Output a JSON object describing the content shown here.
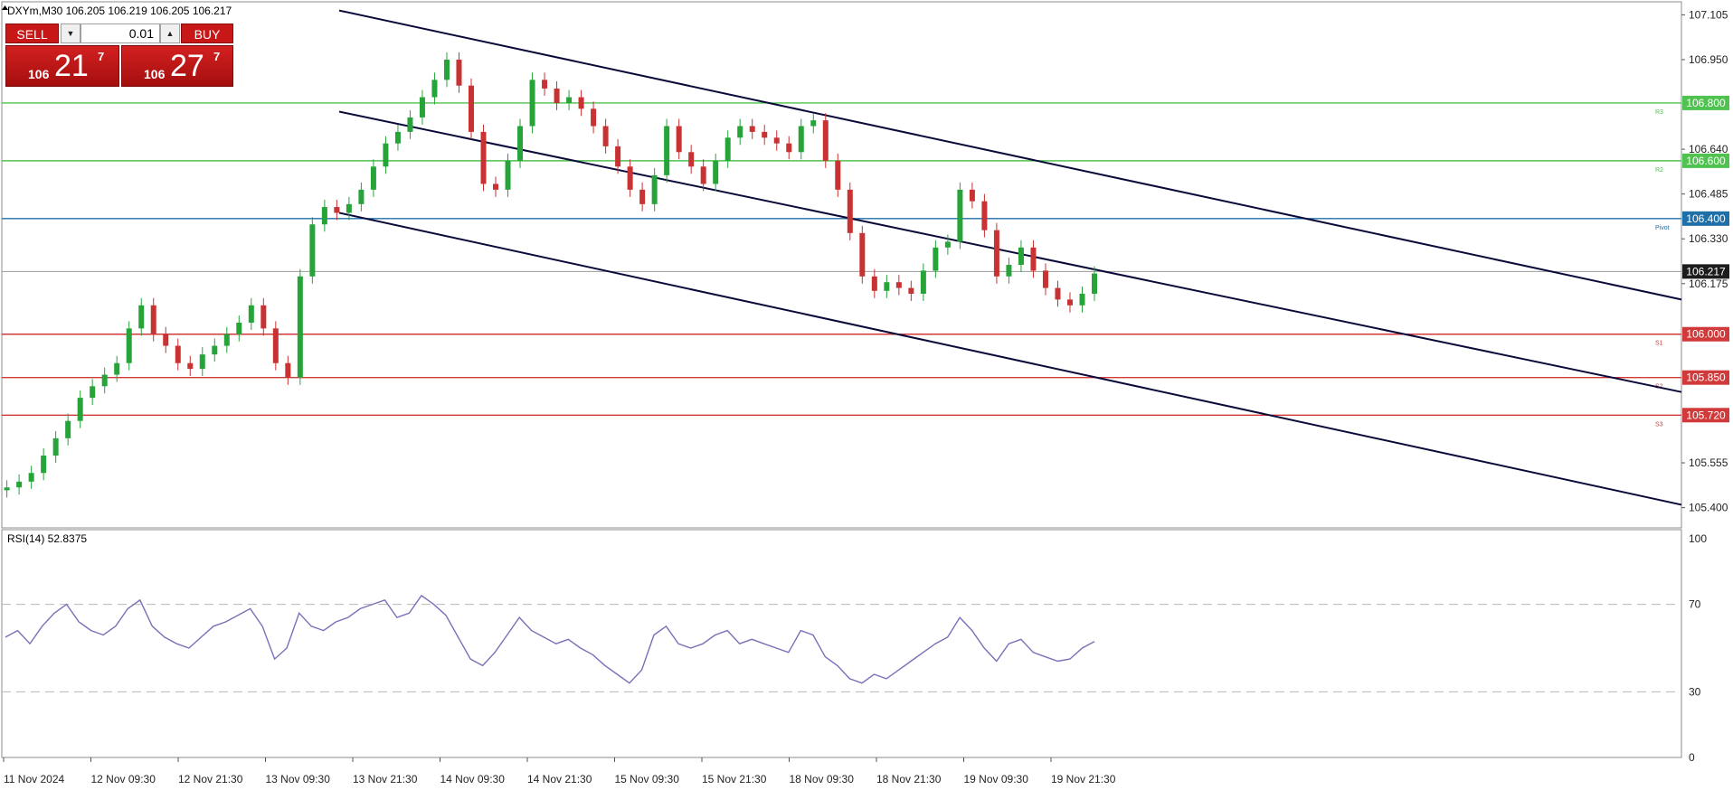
{
  "header": {
    "symbol_info": "DXYm,M30  106.205 106.219 106.205 106.217"
  },
  "trade_panel": {
    "sell_label": "SELL",
    "buy_label": "BUY",
    "lot": "0.01",
    "sell_price": {
      "prefix": "106",
      "big": "21",
      "sup": "7"
    },
    "buy_price": {
      "prefix": "106",
      "big": "27",
      "sup": "7"
    }
  },
  "colors": {
    "support": "#d03a3a",
    "resistance": "#4fc24f",
    "pivot": "#1f6fa8",
    "channel": "#0a0a3a",
    "candle_up": "#26a43a",
    "candle_down": "#c83232",
    "rsi": "#7b6fb8",
    "current": "#1c1c1c"
  },
  "chart_data": [
    {
      "type": "candlestick",
      "title": "DXYm,M30",
      "ylim": [
        105.33,
        107.15
      ],
      "yticks": [
        "107.105",
        "106.950",
        "106.640",
        "106.485",
        "106.330",
        "106.175",
        "105.555",
        "105.400"
      ],
      "x_labels": [
        "11 Nov 2024",
        "12 Nov 09:30",
        "12 Nov 21:30",
        "13 Nov 09:30",
        "13 Nov 21:30",
        "14 Nov 09:30",
        "14 Nov 21:30",
        "15 Nov 09:30",
        "15 Nov 21:30",
        "18 Nov 09:30",
        "18 Nov 21:30",
        "19 Nov 09:30",
        "19 Nov 21:30"
      ],
      "current_price": "106.217",
      "levels": [
        {
          "price": 106.8,
          "label": "106.800",
          "tag": "R3",
          "kind": "resistance"
        },
        {
          "price": 106.6,
          "label": "106.600",
          "tag": "R2",
          "kind": "resistance"
        },
        {
          "price": 106.4,
          "label": "106.400",
          "tag": "Pivot",
          "kind": "pivot"
        },
        {
          "price": 106.0,
          "label": "106.000",
          "tag": "S1",
          "kind": "support"
        },
        {
          "price": 105.85,
          "label": "105.850",
          "tag": "S2",
          "kind": "support"
        },
        {
          "price": 105.72,
          "label": "105.720",
          "tag": "S3",
          "kind": "support"
        }
      ],
      "channel_lines": [
        {
          "x1": 2,
          "y1": 107.12,
          "x2": 163,
          "y2": 106.12
        },
        {
          "x1": 2,
          "y1": 106.77,
          "x2": 163,
          "y2": 105.8
        },
        {
          "x1": 2,
          "y1": 106.42,
          "x2": 163,
          "y2": 105.41
        }
      ],
      "series": [
        {
          "name": "close",
          "values": [
            105.47,
            105.49,
            105.52,
            105.58,
            105.64,
            105.7,
            105.78,
            105.82,
            105.86,
            105.9,
            106.02,
            106.1,
            106.0,
            105.96,
            105.9,
            105.88,
            105.93,
            105.96,
            106.0,
            106.04,
            106.1,
            106.02,
            105.9,
            105.85,
            106.2,
            106.38,
            106.44,
            106.42,
            106.45,
            106.5,
            106.58,
            106.66,
            106.7,
            106.75,
            106.82,
            106.88,
            106.95,
            106.86,
            106.7,
            106.52,
            106.5,
            106.6,
            106.72,
            106.88,
            106.85,
            106.8,
            106.82,
            106.78,
            106.72,
            106.65,
            106.58,
            106.5,
            106.45,
            106.55,
            106.72,
            106.63,
            106.58,
            106.52,
            106.6,
            106.68,
            106.72,
            106.7,
            106.68,
            106.66,
            106.63,
            106.72,
            106.74,
            106.6,
            106.5,
            106.35,
            106.2,
            106.15,
            106.18,
            106.16,
            106.14,
            106.22,
            106.3,
            106.32,
            106.5,
            106.46,
            106.36,
            106.2,
            106.24,
            106.3,
            106.22,
            106.16,
            106.12,
            106.1,
            106.14,
            106.21
          ],
          "role": "close"
        }
      ],
      "sub_chart": {
        "type": "line",
        "title": "RSI(14) 52.8375",
        "ylim": [
          0,
          100
        ],
        "yticks": [
          "100",
          "70",
          "30",
          "0"
        ],
        "levels": [
          70,
          30
        ],
        "values": [
          55,
          58,
          52,
          60,
          66,
          70,
          62,
          58,
          56,
          60,
          68,
          72,
          60,
          55,
          52,
          50,
          55,
          60,
          62,
          65,
          68,
          60,
          45,
          50,
          66,
          60,
          58,
          62,
          64,
          68,
          70,
          72,
          64,
          66,
          74,
          70,
          65,
          55,
          45,
          42,
          48,
          56,
          64,
          58,
          55,
          52,
          54,
          50,
          47,
          42,
          38,
          34,
          40,
          56,
          60,
          52,
          50,
          52,
          56,
          58,
          52,
          54,
          52,
          50,
          48,
          58,
          56,
          46,
          42,
          36,
          34,
          38,
          36,
          40,
          44,
          48,
          52,
          55,
          64,
          58,
          50,
          44,
          52,
          54,
          48,
          46,
          44,
          45,
          50,
          53
        ]
      }
    }
  ]
}
